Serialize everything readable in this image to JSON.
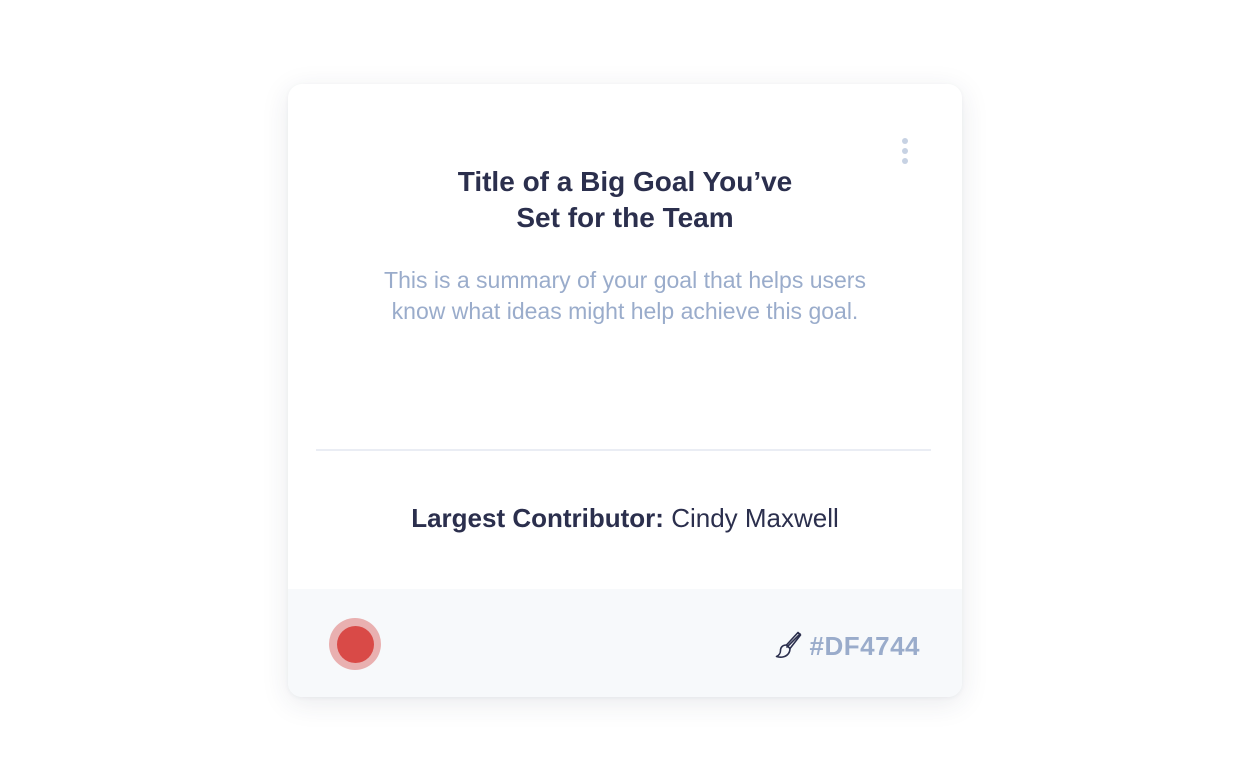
{
  "goal_card": {
    "title_line1": "Title of a Big Goal You’ve",
    "title_line2": "Set for the Team",
    "summary_line1": "This is a summary of your goal that helps users",
    "summary_line2": "know what ideas might help achieve this goal.",
    "contributor_label": "Largest Contributor:",
    "contributor_name": "Cindy Maxwell",
    "menu_icon": "vertical-ellipsis-icon"
  },
  "footer": {
    "color_hex": "#DF4744",
    "swatch_color": "#DF4744",
    "brush_icon": "paintbrush-icon"
  }
}
